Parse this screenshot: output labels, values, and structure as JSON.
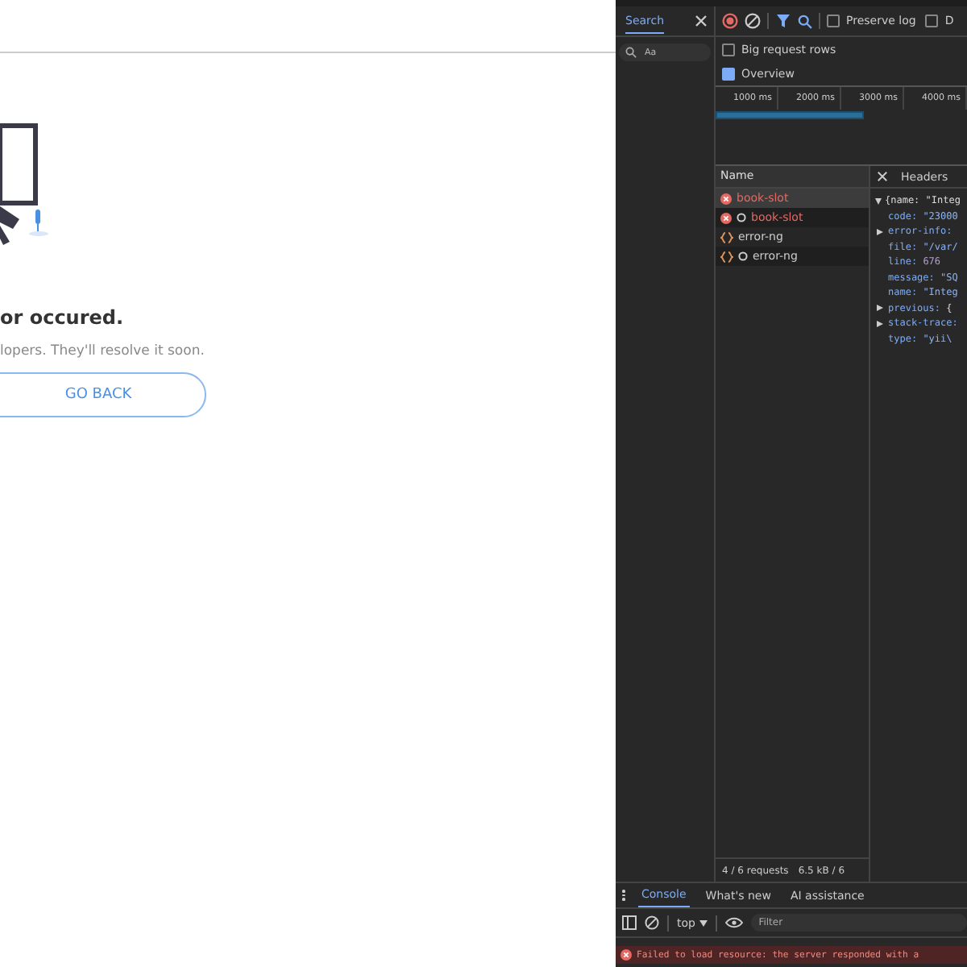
{
  "page": {
    "heading": "or occured.",
    "message": "lopers. They'll resolve it soon.",
    "button": "GO BACK"
  },
  "search_panel": {
    "tab": "Search",
    "case_option": "Aa"
  },
  "toolbar_checkboxes": [
    {
      "label": "Preserve log",
      "checked": false
    },
    {
      "label": "D",
      "checked": false
    }
  ],
  "settings": [
    {
      "label": "Big request rows",
      "checked": false
    },
    {
      "label": "Overview",
      "checked": true
    }
  ],
  "timeline_ticks": [
    "1000 ms",
    "2000 ms",
    "3000 ms",
    "4000 ms"
  ],
  "requests": {
    "column": "Name",
    "rows": [
      {
        "name": "book-slot",
        "kind": "error",
        "preflight": false,
        "selected": true
      },
      {
        "name": "book-slot",
        "kind": "error",
        "preflight": true,
        "selected": false
      },
      {
        "name": "error-ng",
        "kind": "fetch",
        "preflight": false,
        "selected": false
      },
      {
        "name": "error-ng",
        "kind": "fetch",
        "preflight": true,
        "selected": false
      }
    ]
  },
  "detail": {
    "tab": "Headers",
    "root": "{name: \"Integ",
    "lines": [
      {
        "key": "code:",
        "value": "\"23000",
        "kind": "string",
        "expandable": false
      },
      {
        "key": "error-info:",
        "expandable": true
      },
      {
        "key": "file:",
        "value": "\"/var/",
        "kind": "string",
        "expandable": false
      },
      {
        "key": "line:",
        "value": "676",
        "kind": "number",
        "expandable": false
      },
      {
        "key": "message:",
        "value": "\"SQ",
        "kind": "string",
        "expandable": false
      },
      {
        "key": "name:",
        "value": "\"Integ",
        "kind": "string",
        "expandable": false
      },
      {
        "key": "previous:",
        "value": "{",
        "kind": "plain",
        "expandable": true
      },
      {
        "key": "stack-trace:",
        "expandable": true
      },
      {
        "key": "type:",
        "value": "\"yii\\",
        "kind": "string",
        "expandable": false
      }
    ]
  },
  "status": [
    "4 / 6 requests",
    "6.5 kB / 6"
  ],
  "drawer_tabs": [
    {
      "label": "Console",
      "selected": true
    },
    {
      "label": "What's new",
      "selected": false
    },
    {
      "label": "AI assistance",
      "selected": false
    }
  ],
  "console": {
    "context": "top",
    "filter_placeholder": "Filter",
    "error": "Failed to load resource: the server responded with a"
  }
}
